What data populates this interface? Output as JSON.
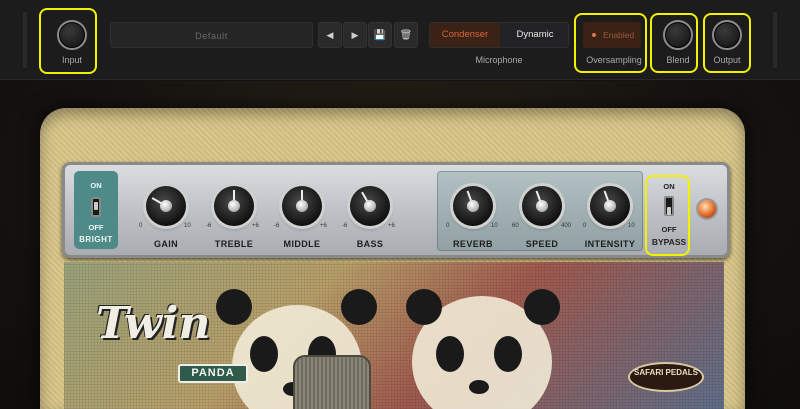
{
  "header": {
    "input_label": "Input",
    "preset_name": "Default",
    "prev_icon": "◀",
    "next_icon": "▶",
    "save_icon": "💾",
    "delete_icon": "🗑",
    "microphone": {
      "options": [
        "Condenser",
        "Dynamic"
      ],
      "selected": "Condenser",
      "label": "Microphone"
    },
    "oversampling": {
      "state": "Enabled",
      "label": "Oversampling"
    },
    "blend_label": "Blend",
    "output_label": "Output"
  },
  "amp": {
    "bright": {
      "on": "ON",
      "off": "OFF",
      "label": "BRIGHT"
    },
    "knobs": [
      {
        "label": "GAIN",
        "min": "0",
        "max": "10"
      },
      {
        "label": "TREBLE",
        "min": "-6",
        "max": "+6"
      },
      {
        "label": "MIDDLE",
        "min": "-6",
        "max": "+6"
      },
      {
        "label": "BASS",
        "min": "-6",
        "max": "+6"
      },
      {
        "label": "REVERB",
        "min": "0",
        "max": "10"
      },
      {
        "label": "SPEED",
        "min": "60",
        "max": "400"
      },
      {
        "label": "INTENSITY",
        "min": "0",
        "max": "10"
      }
    ],
    "bypass": {
      "on": "ON",
      "off": "OFF",
      "label": "BYPASS"
    },
    "logo": "Twin",
    "badge": "PANDA",
    "brand": "SAFARI PEDALS"
  },
  "colors": {
    "highlight": "#f2f200",
    "accent": "#d9653a",
    "bright_panel": "#4e8b88"
  }
}
